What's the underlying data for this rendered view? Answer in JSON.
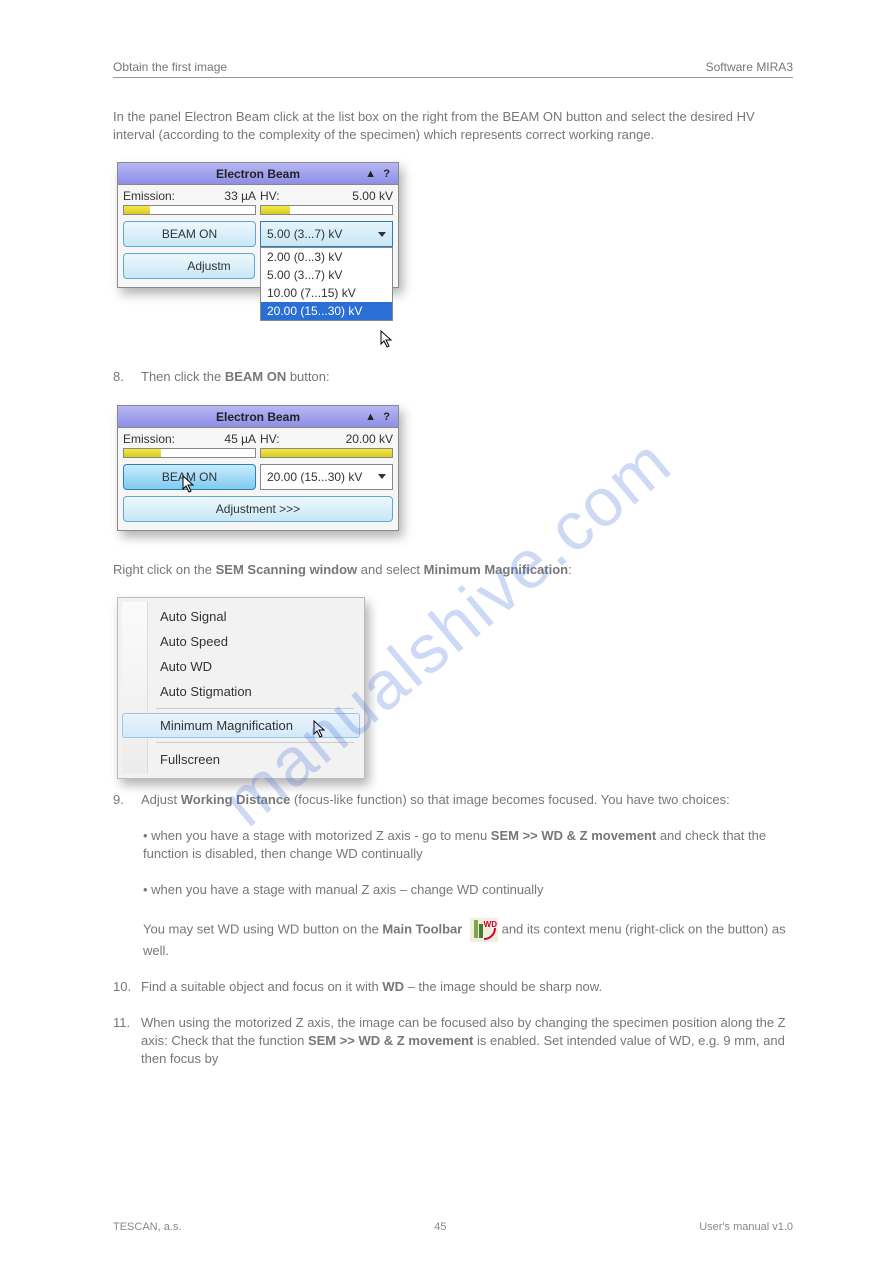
{
  "header": {
    "left": "Obtain the first image",
    "right": "Software MIRA3"
  },
  "intro": "In the panel Electron Beam click at the list box on the right from the BEAM ON button and select the desired HV interval (according to the complexity of the specimen) which represents correct working range",
  "intro_end": ".",
  "panel1": {
    "title": "Electron Beam",
    "emission_label": "Emission:",
    "emission_value": "33 µA",
    "hv_label": "HV:",
    "hv_value": "5.00 kV",
    "emission_fill": "20%",
    "hv_fill": "22%",
    "beam_on": "BEAM ON",
    "adjust_truncated": "Adjustm",
    "select_value": "5.00 (3...7) kV",
    "options": [
      "2.00 (0...3) kV",
      "5.00 (3...7) kV",
      "10.00 (7...15) kV",
      "20.00 (15...30) kV"
    ],
    "hi_index": 3
  },
  "para2_a": "Then click the ",
  "para2_b": "BEAM ON",
  "para2_c": " button:",
  "panel2": {
    "title": "Electron Beam",
    "emission_label": "Emission:",
    "emission_value": "45 µA",
    "hv_label": "HV:",
    "hv_value": "20.00 kV",
    "emission_fill": "28%",
    "hv_fill": "100%",
    "beam_on": "BEAM ON",
    "select_value": "20.00 (15...30) kV",
    "adjust": "Adjustment  >>>"
  },
  "para3_a": "Right click on the ",
  "para3_b": "SEM Scanning window",
  "para3_c": " and select ",
  "para3_d": "Minimum Magnification",
  "para3_e": ":",
  "ctx": {
    "items_top": [
      "Auto Signal",
      "Auto Speed",
      "Auto WD",
      "Auto Stigmation"
    ],
    "highlight": "Minimum Magnification",
    "items_bottom": [
      "Fullscreen"
    ]
  },
  "sec9": {
    "num": "9.",
    "a": "Adjust ",
    "b": "Working Distance",
    "c": "(focus-like function) so that image becomes focused. You have two choices:",
    "bul_a_1": "when you have a stage with motorized Z axis - go to menu ",
    "bul_a_2": "SEM >> WD & Z movement",
    "bul_a_3": " and check that the function is disabled, then change WD continually",
    "bul_b_1": "when you have a stage with manual Z axis – change WD continually",
    "cont_1": "You may set WD using WD button on the ",
    "cont_2": "Main Toolbar ",
    "cont_3": "and its context menu (right-click on the button) as well.",
    "wd_label": "WD"
  },
  "sec10": {
    "num": "10.",
    "a": "Find a suitable object and focus on it with ",
    "b": "WD",
    "c": " – the image should be sharp now."
  },
  "sec11": {
    "num": "11.",
    "a": "When using the motorized Z axis, the image can be focused also by changing the specimen position along the Z axis: Check that the function ",
    "b": "SEM >> WD & Z movement",
    "c": " is enabled. Set intended value of WD, e.g. 9 mm, and then focus by "
  },
  "footer": {
    "left": "TESCAN, a.s.",
    "center": "45",
    "right": "User's manual v1.0"
  },
  "watermark": "manualshive.com"
}
